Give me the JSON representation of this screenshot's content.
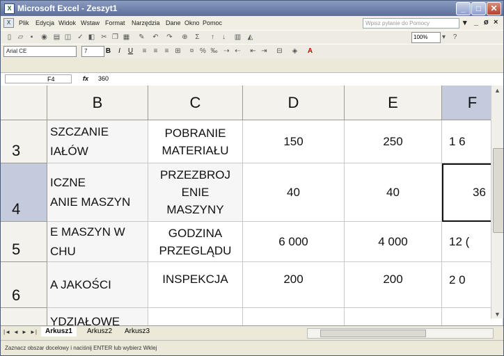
{
  "window": {
    "title": "Microsoft Excel - Zeszyt1"
  },
  "menu": {
    "items": [
      "Plik",
      "Edycja",
      "Widok",
      "Wstaw",
      "Format",
      "Narzędzia",
      "Dane",
      "Okno",
      "Pomoc"
    ],
    "help_placeholder": "Wpisz pytanie do Pomocy"
  },
  "format": {
    "font_name": "Arial CE",
    "font_size": "7",
    "zoom": "100%"
  },
  "formula_bar": {
    "cell_ref": "F4",
    "fx": "fx",
    "value": "360"
  },
  "columns": [
    "B",
    "C",
    "D",
    "E",
    "F"
  ],
  "rows": [
    {
      "num": "3",
      "b": "SZCZANIE\nIAŁÓW",
      "c": "POBRANIE\nMATERIAŁU",
      "d": "150",
      "e": "250",
      "f": "1 6"
    },
    {
      "num": "4",
      "b": "ICZNE\nANIE MASZYN",
      "c": "PRZEZBROJ\nENIE\nMASZYNY",
      "d": "40",
      "e": "40",
      "f": "36"
    },
    {
      "num": "5",
      "b": "E MASZYN W\nCHU",
      "c": "GODZINA\nPRZEGLĄDU",
      "d": "6 000",
      "e": "4 000",
      "f": "12 ("
    },
    {
      "num": "6",
      "b": "A JAKOŚCI",
      "c": "INSPEKCJA",
      "d": "200",
      "e": "200",
      "f": "2 0"
    },
    {
      "num": "",
      "b": "YDZIAŁOWE",
      "c": "",
      "d": "",
      "e": "",
      "f": ""
    }
  ],
  "sheets": [
    "Arkusz1",
    "Arkusz2",
    "Arkusz3"
  ],
  "status": {
    "text": "Zaznacz obszar docelowy i naciśnij ENTER lub wybierz Wklej"
  }
}
